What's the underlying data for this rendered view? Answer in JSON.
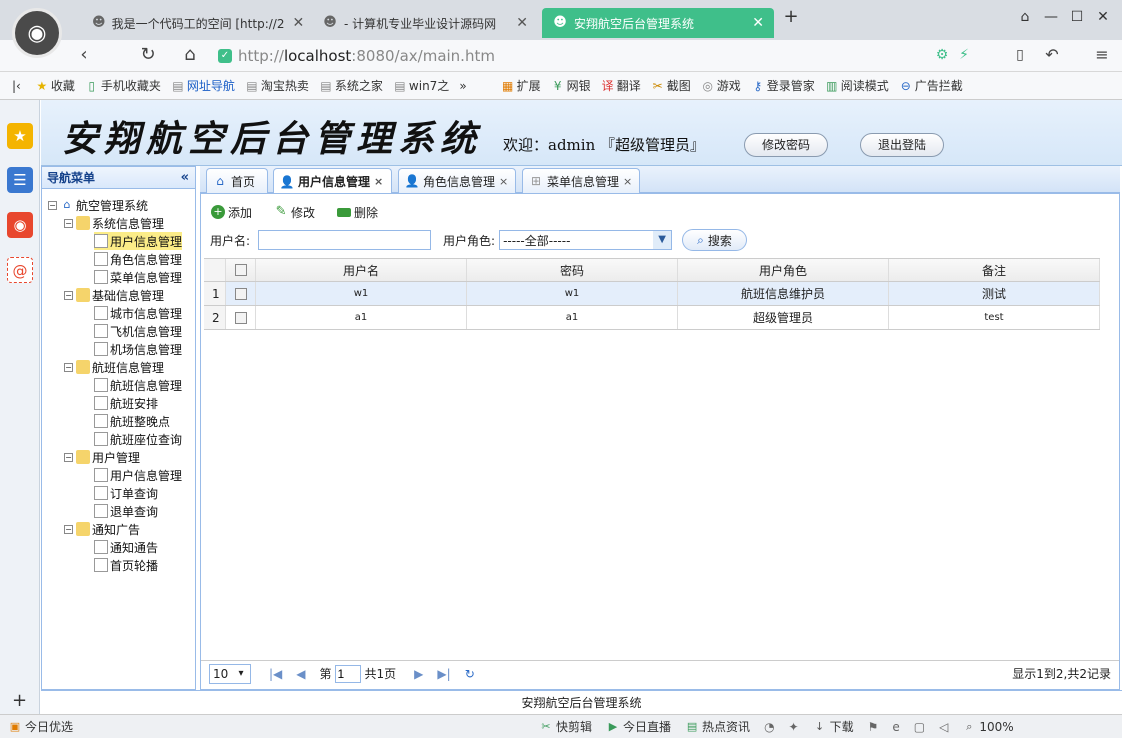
{
  "browser": {
    "tabs": [
      {
        "label": "我是一个代码工的空间 [http://2",
        "icon": "mask-icon"
      },
      {
        "label": "- 计算机专业毕业设计源码网",
        "icon": "mask-icon"
      },
      {
        "label": "安翔航空后台管理系统",
        "icon": "mask-icon"
      }
    ],
    "new_tab": "+",
    "url_host": "localhost",
    "url_prefix": "http://",
    "url_rest": ":8080/ax/main.htm"
  },
  "bookmarks": [
    "收藏",
    "手机收藏夹",
    "网址导航",
    "淘宝热卖",
    "系统之家",
    "win7之"
  ],
  "bookmarks_right": [
    "扩展",
    "网银",
    "翻译",
    "截图",
    "游戏",
    "登录管家",
    "阅读模式",
    "广告拦截"
  ],
  "app": {
    "title": "安翔航空后台管理系统",
    "welcome": "欢迎：admin 『超级管理员』",
    "change_password": "修改密码",
    "logout": "退出登陆",
    "footer": "安翔航空后台管理系统"
  },
  "menu": {
    "header": "导航菜单",
    "collapse": "«",
    "root": "航空管理系统",
    "groups": [
      {
        "label": "系统信息管理",
        "items": [
          "用户信息管理",
          "角色信息管理",
          "菜单信息管理"
        ]
      },
      {
        "label": "基础信息管理",
        "items": [
          "城市信息管理",
          "飞机信息管理",
          "机场信息管理"
        ]
      },
      {
        "label": "航班信息管理",
        "items": [
          "航班信息管理",
          "航班安排",
          "航班整晚点",
          "航班座位查询"
        ]
      },
      {
        "label": "用户管理",
        "items": [
          "用户信息管理",
          "订单查询",
          "退单查询"
        ]
      },
      {
        "label": "通知广告",
        "items": [
          "通知通告",
          "首页轮播"
        ]
      }
    ]
  },
  "tabs": [
    {
      "label": "首页"
    },
    {
      "label": "用户信息管理",
      "close": "×"
    },
    {
      "label": "角色信息管理",
      "close": "×"
    },
    {
      "label": "菜单信息管理",
      "close": "×"
    }
  ],
  "toolbar": {
    "add": "添加",
    "edit": "修改",
    "delete": "删除"
  },
  "search": {
    "username_label": "用户名:",
    "username_value": "",
    "role_label": "用户角色:",
    "role_value": "-----全部-----",
    "button": "搜索"
  },
  "table": {
    "columns": [
      "用户名",
      "密码",
      "用户角色",
      "备注"
    ],
    "rows": [
      {
        "num": "1",
        "cells": [
          "w1",
          "w1",
          "航班信息维护员",
          "测试"
        ]
      },
      {
        "num": "2",
        "cells": [
          "a1",
          "a1",
          "超级管理员",
          "test"
        ]
      }
    ]
  },
  "pager": {
    "page_size": "10",
    "page_prefix": "第",
    "page": "1",
    "page_total": "共1页",
    "info": "显示1到2,共2记录"
  },
  "status": {
    "left": "今日优选",
    "items": [
      "快剪辑",
      "今日直播",
      "热点资讯",
      "下载"
    ],
    "zoom": "100%"
  }
}
